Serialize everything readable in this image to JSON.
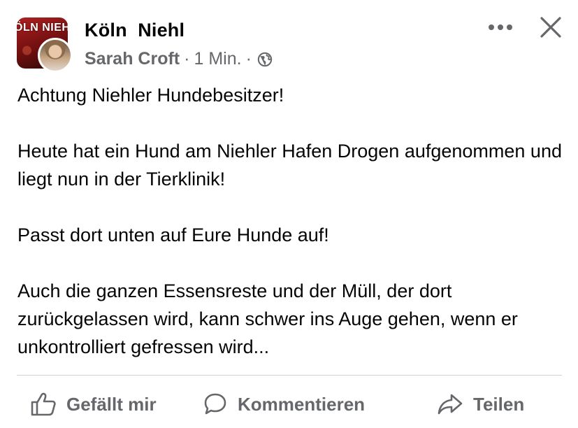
{
  "header": {
    "group_name": "Köln  Niehl",
    "group_logo_text": "ÖLN NIEH",
    "author": "Sarah Croft",
    "time": "1 Min.",
    "separator": "·"
  },
  "post": {
    "paragraphs": [
      "Achtung Niehler Hundebesitzer!",
      "Heute hat ein Hund am Niehler Hafen Drogen aufgenommen und liegt nun in der Tierklinik!",
      "Passt dort unten auf Eure Hunde auf!",
      "Auch die ganzen Essensreste und der Müll, der dort zurückgelassen wird, kann schwer ins Auge gehen, wenn er unkontrolliert gefressen wird..."
    ]
  },
  "actions": {
    "like_label": "Gefällt mir",
    "comment_label": "Kommentieren",
    "share_label": "Teilen"
  },
  "icons": {
    "more": "more-horizontal-icon",
    "close": "close-icon",
    "audience": "globe-icon",
    "like": "thumbs-up-icon",
    "comment": "comment-bubble-icon",
    "share": "share-arrow-icon"
  },
  "colors": {
    "text_primary": "#050505",
    "text_secondary": "#65676b",
    "divider": "#ced0d4"
  }
}
